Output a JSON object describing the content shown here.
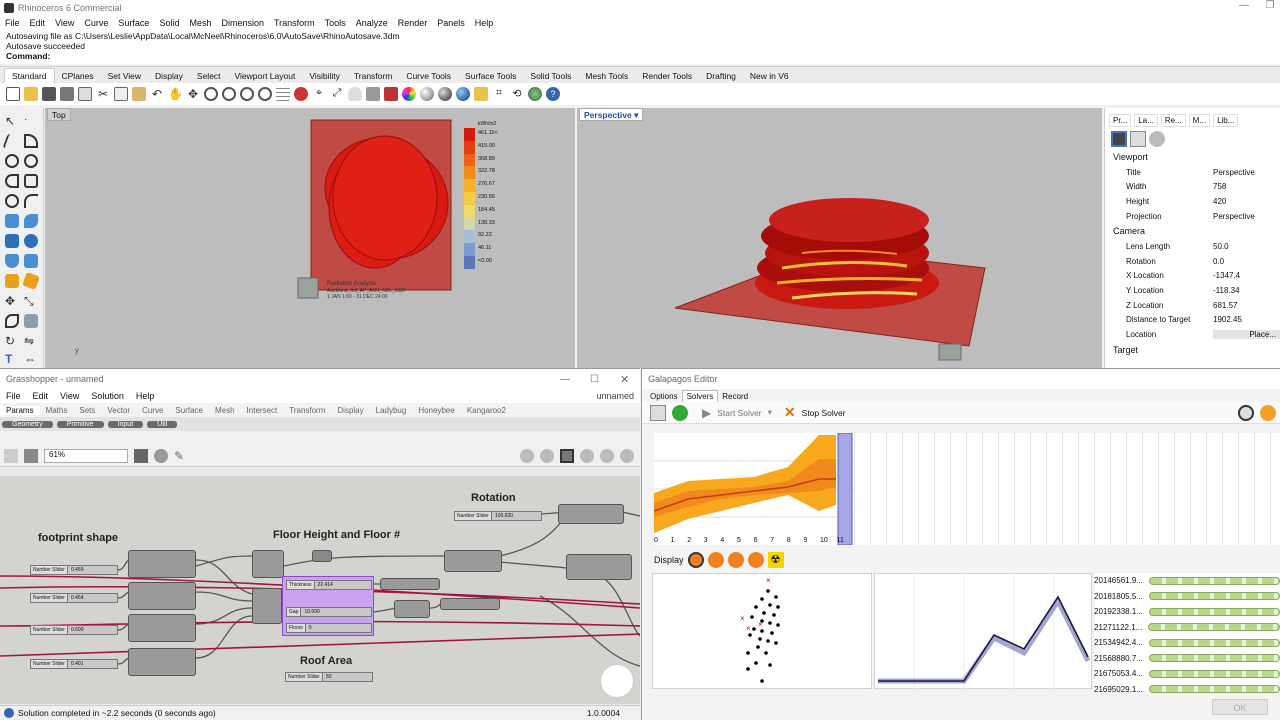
{
  "app": {
    "title": "Rhinoceros 6 Commercial"
  },
  "menu": [
    "File",
    "Edit",
    "View",
    "Curve",
    "Surface",
    "Solid",
    "Mesh",
    "Dimension",
    "Transform",
    "Tools",
    "Analyze",
    "Render",
    "Panels",
    "Help"
  ],
  "command": {
    "lines": [
      "Autosaving file as C:\\Users\\Leslie\\AppData\\Local\\McNeel\\Rhinoceros\\6.0\\AutoSave\\RhinoAutosave.3dm",
      "Autosave succeeded"
    ],
    "prompt": "Command:"
  },
  "tabs": [
    "Standard",
    "CPlanes",
    "Set View",
    "Display",
    "Select",
    "Viewport Layout",
    "Visibility",
    "Transform",
    "Curve Tools",
    "Surface Tools",
    "Solid Tools",
    "Mesh Tools",
    "Render Tools",
    "Drafting",
    "New in V6"
  ],
  "viewports": {
    "top": "Top",
    "perspective": "Perspective"
  },
  "legend": {
    "unit": "kWh/m2",
    "values": [
      "461.11<",
      "415.00",
      "368.89",
      "322.78",
      "276.67",
      "230.56",
      "184.45",
      "138.33",
      "92.22",
      "46.11",
      "<0.00"
    ],
    "colors": [
      "#d41a10",
      "#e23f12",
      "#ea6316",
      "#f08c1c",
      "#f6b02a",
      "#f5cc4a",
      "#eedc6a",
      "#d0d8a8",
      "#a8bcd8",
      "#7d9bd0",
      "#5c76bb"
    ]
  },
  "analysis": {
    "title": "Radiation Analysis",
    "location": "Auckland_Intl_AP_AUK_NZL_1987",
    "period": "1 JAN 1:00 - 31 DEC 24:00"
  },
  "props": {
    "tabs": [
      "Pr...",
      "La...",
      "Re...",
      "M...",
      "Lib..."
    ],
    "viewport_header": "Viewport",
    "camera_header": "Camera",
    "target_header": "Target",
    "viewport": [
      [
        "Title",
        "Perspective"
      ],
      [
        "Width",
        "758"
      ],
      [
        "Height",
        "420"
      ],
      [
        "Projection",
        "Perspective"
      ]
    ],
    "camera": [
      [
        "Lens Length",
        "50.0"
      ],
      [
        "Rotation",
        "0.0"
      ],
      [
        "X Location",
        "-1347.4"
      ],
      [
        "Y Location",
        "-118.34"
      ],
      [
        "Z Location",
        "681.57"
      ],
      [
        "Distance to Target",
        "1902.45"
      ],
      [
        "Location",
        "Place..."
      ]
    ]
  },
  "gh": {
    "title": "Grasshopper - unnamed",
    "doc": "unnamed",
    "menu": [
      "File",
      "Edit",
      "View",
      "Solution",
      "Help"
    ],
    "tabs": [
      "Params",
      "Maths",
      "Sets",
      "Vector",
      "Curve",
      "Surface",
      "Mesh",
      "Intersect",
      "Transform",
      "Display",
      "Ladybug",
      "Honeybee",
      "Kangaroo2"
    ],
    "subtabs": [
      "Geometry",
      "Primitive",
      "Input",
      "Util"
    ],
    "zoom": "61%",
    "labels": {
      "footprint": "footprint shape",
      "floor": "Floor Height and Floor #",
      "rotation": "Rotation",
      "roof": "Roof Area"
    },
    "sliders": [
      {
        "label": "Number Slider",
        "value": "0.459"
      },
      {
        "label": "Number Slider",
        "value": "0.464"
      },
      {
        "label": "Number Slider",
        "value": "0.600"
      },
      {
        "label": "Number Slider",
        "value": "0.401"
      },
      {
        "label": "Thickness",
        "value": "22.414"
      },
      {
        "label": "Gap",
        "value": "10.690"
      },
      {
        "label": "Floors",
        "value": "5"
      },
      {
        "label": "Number Slider",
        "value": "106.620"
      },
      {
        "label": "Number Slider",
        "value": "50"
      }
    ],
    "status": "Solution completed in ~2.2 seconds (0 seconds ago)",
    "version": "1.0.0004"
  },
  "gal": {
    "title": "Galapagos Editor",
    "tabs": [
      "Options",
      "Solvers",
      "Record"
    ],
    "start": "Start Solver",
    "stop": "Stop Solver",
    "display": "Display",
    "gens": [
      "0",
      "1",
      "2",
      "3",
      "4",
      "5",
      "6",
      "7",
      "8",
      "9",
      "10",
      "11"
    ],
    "values": [
      "20146561.9...",
      "20181805.5...",
      "20192338.1...",
      "21271122.1...",
      "21534942.4...",
      "21568880.7...",
      "21675053.4...",
      "21695029.1..."
    ],
    "ok": "OK"
  }
}
